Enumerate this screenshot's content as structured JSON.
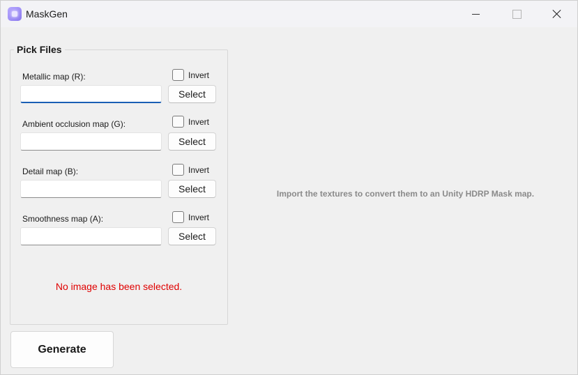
{
  "window": {
    "title": "MaskGen",
    "icons": {
      "app": "maskgen-app-icon",
      "minimize": "minimize-icon",
      "maximize": "maximize-icon",
      "close": "close-icon"
    }
  },
  "pick_files": {
    "title": "Pick Files",
    "fields": [
      {
        "label": "Metallic map (R):",
        "value": "",
        "invert_label": "Invert",
        "invert_checked": false,
        "select_label": "Select"
      },
      {
        "label": "Ambient occlusion map (G):",
        "value": "",
        "invert_label": "Invert",
        "invert_checked": false,
        "select_label": "Select"
      },
      {
        "label": "Detail map (B):",
        "value": "",
        "invert_label": "Invert",
        "invert_checked": false,
        "select_label": "Select"
      },
      {
        "label": "Smoothness map (A):",
        "value": "",
        "invert_label": "Invert",
        "invert_checked": false,
        "select_label": "Select"
      }
    ],
    "error": "No image has been selected."
  },
  "generate_label": "Generate",
  "preview_message": "Import the textures to convert them to an Unity HDRP Mask map.",
  "colors": {
    "error": "#e00000",
    "focus_accent": "#1a5fb4",
    "hint": "#8a8a8a"
  }
}
